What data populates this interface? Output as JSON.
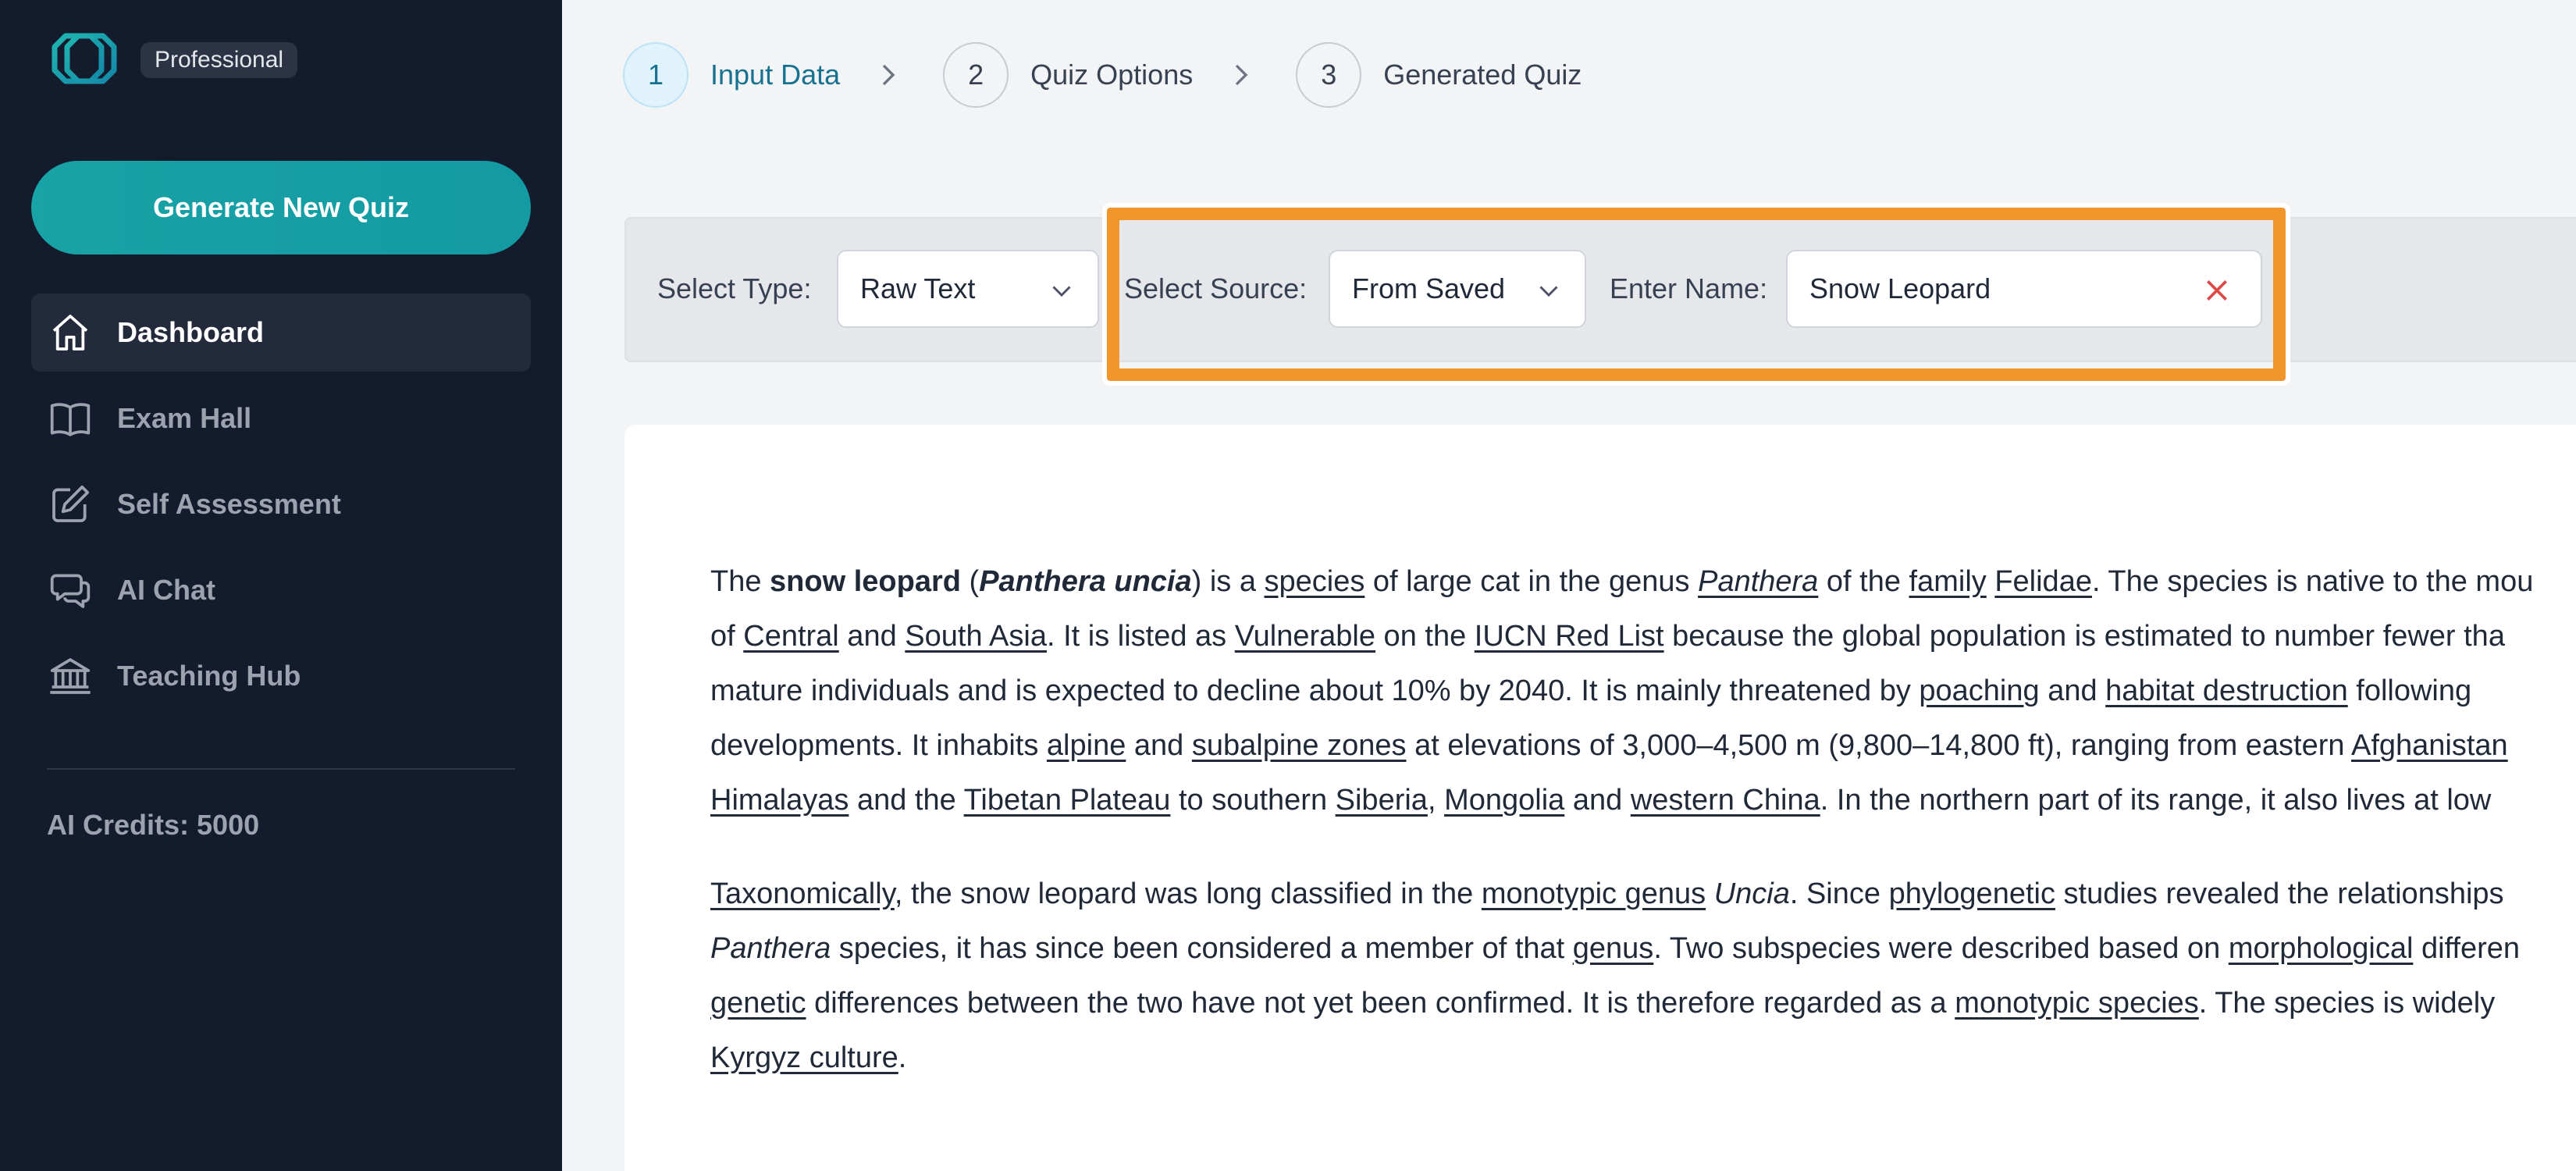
{
  "sidebar": {
    "plan_badge": "Professional",
    "new_quiz_label": "Generate New Quiz",
    "nav": [
      {
        "label": "Dashboard",
        "icon": "home-icon"
      },
      {
        "label": "Exam Hall",
        "icon": "book-icon"
      },
      {
        "label": "Self Assessment",
        "icon": "edit-icon"
      },
      {
        "label": "AI Chat",
        "icon": "chat-icon"
      },
      {
        "label": "Teaching Hub",
        "icon": "institution-icon"
      }
    ],
    "credits": "AI Credits: 5000"
  },
  "stepper": {
    "steps": [
      {
        "number": "1",
        "label": "Input Data"
      },
      {
        "number": "2",
        "label": "Quiz Options"
      },
      {
        "number": "3",
        "label": "Generated Quiz"
      }
    ]
  },
  "filters": {
    "type_label": "Select Type:",
    "type_value": "Raw Text",
    "source_label": "Select Source:",
    "source_value": "From Saved",
    "name_label": "Enter Name:",
    "name_value": "Snow Leopard"
  },
  "article": {
    "p1": [
      [
        "The ",
        {
          "b": "snow leopard"
        },
        " (",
        {
          "bi": "Panthera uncia"
        },
        ") is a ",
        {
          "a": "species"
        },
        " of large cat in the genus ",
        {
          "ai": "Panthera"
        },
        " of the ",
        {
          "a": "family"
        },
        " ",
        {
          "a": "Felidae"
        },
        ". The species is native to the mou"
      ],
      [
        "of ",
        {
          "a": "Central"
        },
        " and ",
        {
          "a": "South Asia"
        },
        ". It is listed as ",
        {
          "a": "Vulnerable"
        },
        " on the ",
        {
          "a": "IUCN Red List"
        },
        " because the global population is estimated to number fewer tha"
      ],
      [
        "mature individuals and is expected to decline about 10% by 2040. It is mainly threatened by ",
        {
          "a": "poaching"
        },
        " and ",
        {
          "a": "habitat destruction"
        },
        " following"
      ],
      [
        "developments. It inhabits ",
        {
          "a": "alpine"
        },
        " and ",
        {
          "a": "subalpine zones"
        },
        " at elevations of 3,000–4,500 m (9,800–14,800 ft), ranging from eastern ",
        {
          "a": "Afghanistan"
        }
      ],
      [
        {
          "a": "Himalayas"
        },
        " and the ",
        {
          "a": "Tibetan Plateau"
        },
        " to southern ",
        {
          "a": "Siberia"
        },
        ", ",
        {
          "a": "Mongolia"
        },
        " and ",
        {
          "a": "western China"
        },
        ". In the northern part of its range, it also lives at low"
      ]
    ],
    "p2": [
      [
        {
          "a": "Taxonomically"
        },
        ", the snow leopard was long classified in the ",
        {
          "a": "monotypic genus"
        },
        " ",
        {
          "i": "Uncia"
        },
        ". Since ",
        {
          "a": "phylogenetic"
        },
        " studies revealed the relationships"
      ],
      [
        {
          "i": "Panthera"
        },
        " species, it has since been considered a member of that ",
        {
          "a": "genus"
        },
        ". Two subspecies were described based on ",
        {
          "a": "morphological"
        },
        " differen"
      ],
      [
        {
          "a": "genetic"
        },
        " differences between the two have not yet been confirmed. It is therefore regarded as a ",
        {
          "a": "monotypic species"
        },
        ". The species is widely"
      ],
      [
        {
          "a": "Kyrgyz culture"
        },
        "."
      ]
    ]
  }
}
